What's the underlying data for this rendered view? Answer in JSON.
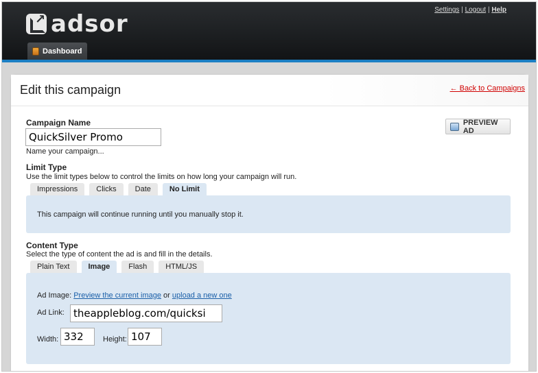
{
  "header": {
    "logo_text": "adsor",
    "links": {
      "settings": "Settings",
      "sep1": "|",
      "logout": "Logout",
      "sep2": "|",
      "help": "Help"
    },
    "nav_tab": "Dashboard"
  },
  "page": {
    "title": "Edit this campaign",
    "back_link": "← Back to Campaigns",
    "preview_button": "PREVIEW AD"
  },
  "campaign_name": {
    "label": "Campaign Name",
    "value": "QuickSilver Promo",
    "hint": "Name your campaign..."
  },
  "limit_type": {
    "label": "Limit Type",
    "hint": "Use the limit types below to control the limits on how long your campaign will run.",
    "tabs": [
      "Impressions",
      "Clicks",
      "Date",
      "No Limit"
    ],
    "active_tab": "No Limit",
    "message": "This campaign will continue running until you manually stop it."
  },
  "content_type": {
    "label": "Content Type",
    "hint": "Select the type of content the ad is and fill in the details.",
    "tabs": [
      "Plain Text",
      "Image",
      "Flash",
      "HTML/JS"
    ],
    "active_tab": "Image",
    "ad_image_label": "Ad Image:",
    "preview_image_link": "Preview the current image",
    "or_text": "or",
    "upload_link": "upload a new one",
    "ad_link_label": "Ad Link:",
    "ad_link_value": "theappleblog.com/quicksi",
    "width_label": "Width:",
    "width_value": "332",
    "height_label": "Height:",
    "height_value": "107"
  },
  "colors": {
    "accent_blue": "#1c7fc4",
    "tab_panel": "#dbe7f3",
    "back_link": "#d00000"
  }
}
